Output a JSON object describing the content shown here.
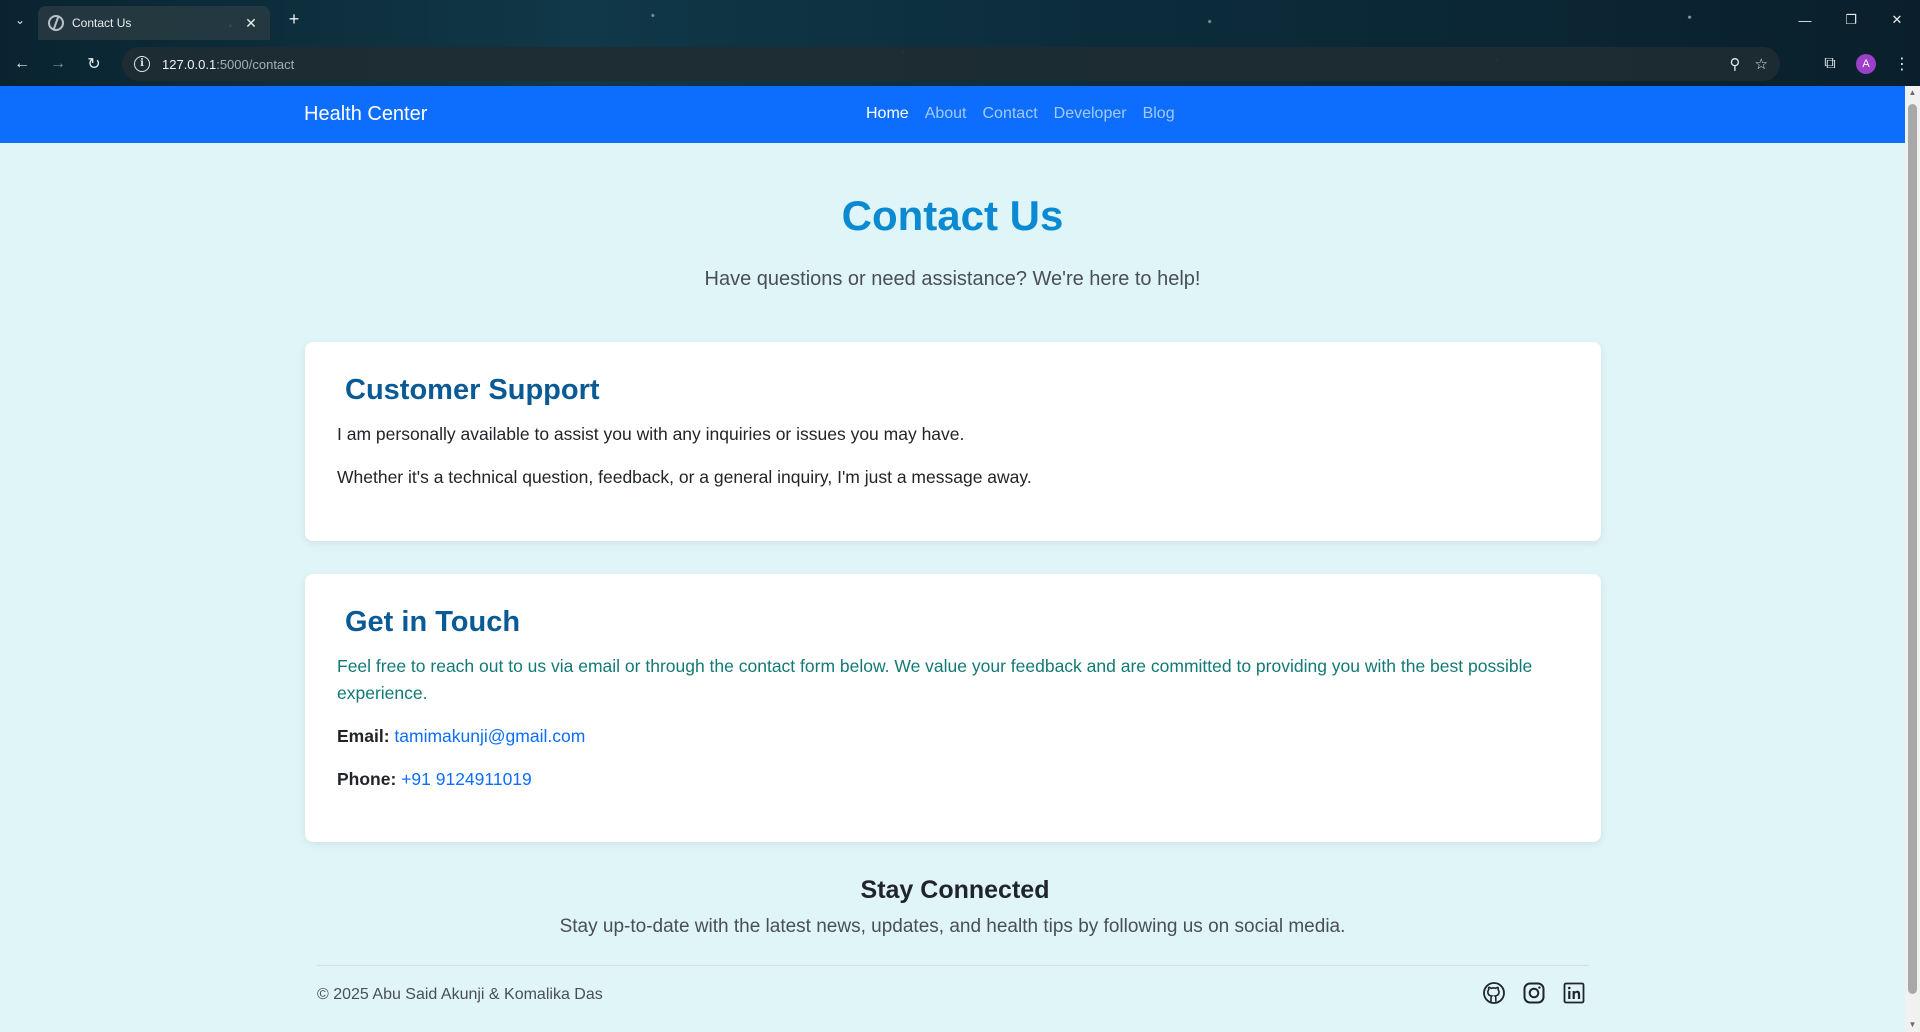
{
  "browser": {
    "tab_title": "Contact Us",
    "url_host": "127.0.0.1",
    "url_path": ":5000/contact",
    "profile_initial": "A"
  },
  "navbar": {
    "brand": "Health Center",
    "links": [
      "Home",
      "About",
      "Contact",
      "Developer",
      "Blog"
    ],
    "active": "Home",
    "color": "#0d6efd"
  },
  "hero": {
    "title": "Contact Us",
    "subtitle": "Have questions or need assistance? We're here to help!"
  },
  "support_card": {
    "title": "Customer Support",
    "p1": "I am personally available to assist you with any inquiries or issues you may have.",
    "p2": "Whether it's a technical question, feedback, or a general inquiry, I'm just a message away."
  },
  "contact_card": {
    "title": "Get in Touch",
    "lead": "Feel free to reach out to us via email or through the contact form below. We value your feedback and are committed to providing you with the best possible experience.",
    "email_label": "Email:",
    "email": "tamimakunji@gmail.com",
    "phone_label": "Phone:",
    "phone": "+91 9124911019"
  },
  "footer": {
    "stay_title": "Stay Connected",
    "stay_sub": "Stay up-to-date with the latest news, updates, and health tips by following us on social media.",
    "copyright": "© 2025 Abu Said Akunji & Komalika Das",
    "socials": [
      "github-icon",
      "instagram-icon",
      "linkedin-icon"
    ]
  },
  "colors": {
    "page_bg": "#dff5f8",
    "hero_title": "#0b8ad1",
    "card_title": "#0a5a96",
    "lead_text": "#127a74",
    "link": "#0d6efd"
  }
}
